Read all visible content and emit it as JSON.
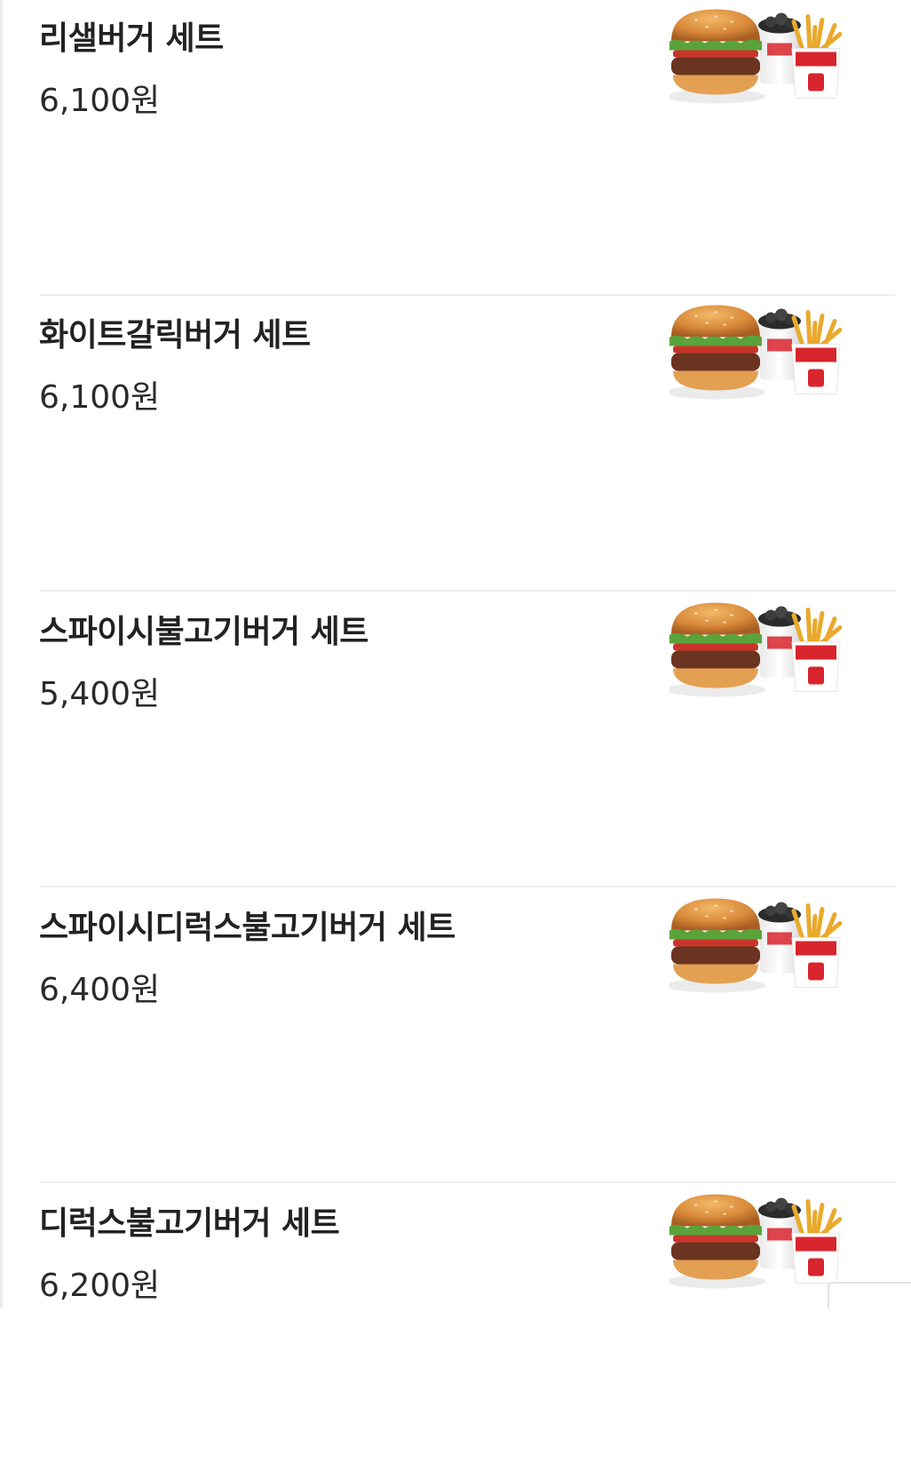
{
  "menu": {
    "items": [
      {
        "name": "리샐버거 세트",
        "price": "6,100원",
        "image": "burger-set-photo"
      },
      {
        "name": "화이트갈릭버거 세트",
        "price": "6,100원",
        "image": "burger-set-photo"
      },
      {
        "name": "스파이시불고기버거 세트",
        "price": "5,400원",
        "image": "burger-set-photo"
      },
      {
        "name": "스파이시디럭스불고기버거 세트",
        "price": "6,400원",
        "image": "burger-set-photo"
      },
      {
        "name": "디럭스불고기버거 세트",
        "price": "6,200원",
        "image": "burger-set-photo"
      }
    ]
  },
  "colors": {
    "background": "#ffffff",
    "divider": "#eeeeee",
    "bun": "#d98a3a",
    "lettuce": "#5aa33a",
    "patty": "#6b3420",
    "brand_red": "#d8252d"
  }
}
